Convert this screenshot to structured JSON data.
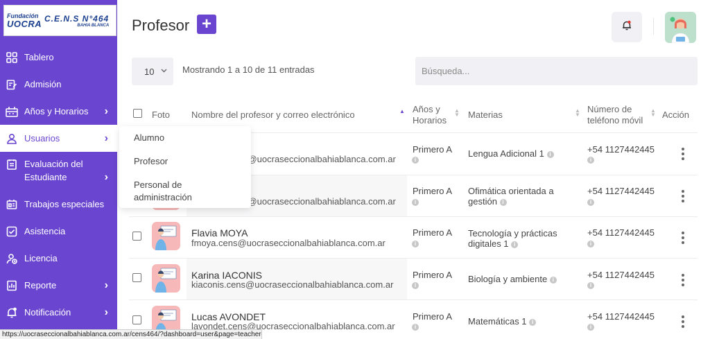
{
  "logo": {
    "fundacion": "Fundación",
    "uocra": "UOCRA",
    "cens": "C.E.N.S N°464",
    "city": "BAHIA BLANCA"
  },
  "sidebar": {
    "items": [
      {
        "label": "Tablero",
        "icon": "dashboard-icon",
        "chevron": ""
      },
      {
        "label": "Admisión",
        "icon": "admission-icon",
        "chevron": ""
      },
      {
        "label": "Años y Horarios",
        "icon": "schedule-icon",
        "chevron": "›"
      },
      {
        "label": "Usuarios",
        "icon": "user-icon",
        "chevron": "›"
      },
      {
        "label": "Evaluación del Estudiante",
        "icon": "evaluation-icon",
        "chevron": "›"
      },
      {
        "label": "Trabajos especiales",
        "icon": "special-works-icon",
        "chevron": ""
      },
      {
        "label": "Asistencia",
        "icon": "attendance-icon",
        "chevron": ""
      },
      {
        "label": "Licencia",
        "icon": "license-icon",
        "chevron": ""
      },
      {
        "label": "Reporte",
        "icon": "report-icon",
        "chevron": "›"
      },
      {
        "label": "Notificación",
        "icon": "notification-icon",
        "chevron": "›"
      }
    ],
    "submenu": [
      "Alumno",
      "Profesor",
      "Personal de administración"
    ]
  },
  "header": {
    "title": "Profesor",
    "add_label": "+"
  },
  "controls": {
    "page_size": "10",
    "showing": "Mostrando 1 a 10 de 11 entradas",
    "search_placeholder": "Búsqueda..."
  },
  "table": {
    "columns": {
      "photo": "Foto",
      "name": "Nombre del profesor y correo electrónico",
      "years": "Años y Horarios",
      "subjects": "Materias",
      "phone": "Número de teléfono móvil",
      "action": "Acción"
    },
    "info_glyph": "i",
    "rows": [
      {
        "name": "",
        "email": "cens@uocraseccionalbahiablanca.com.ar",
        "year": "Primero A",
        "subject": "Lengua Adicional 1",
        "phone": "+54 1127442445"
      },
      {
        "name": "",
        "email": "cens@uocraseccionalbahiablanca.com.ar",
        "year": "Primero A",
        "subject": "Ofimática orientada a gestión",
        "phone": "+54 1127442445"
      },
      {
        "name": "Flavia MOYA",
        "email": "fmoya.cens@uocraseccionalbahiablanca.com.ar",
        "year": "Primero A",
        "subject": "Tecnología y prácticas digitales 1",
        "phone": "+54 1127442445"
      },
      {
        "name": "Karina IACONIS",
        "email": "kiaconis.cens@uocraseccionalbahiablanca.com.ar",
        "year": "Primero A",
        "subject": "Biología y ambiente",
        "phone": "+54 1127442445"
      },
      {
        "name": "Lucas AVONDET",
        "email": "lavondet.cens@uocraseccionalbahiablanca.com.ar",
        "year": "Primero A",
        "subject": "Matemáticas 1",
        "phone": "+54 1127442445"
      }
    ]
  },
  "statusbar": {
    "url": "https://uocraseccionalbahiablanca.com.ar/cens464/?dashboard=user&page=teacher#"
  },
  "colors": {
    "brand": "#6a45cf",
    "surface": "#f1f1f5"
  }
}
